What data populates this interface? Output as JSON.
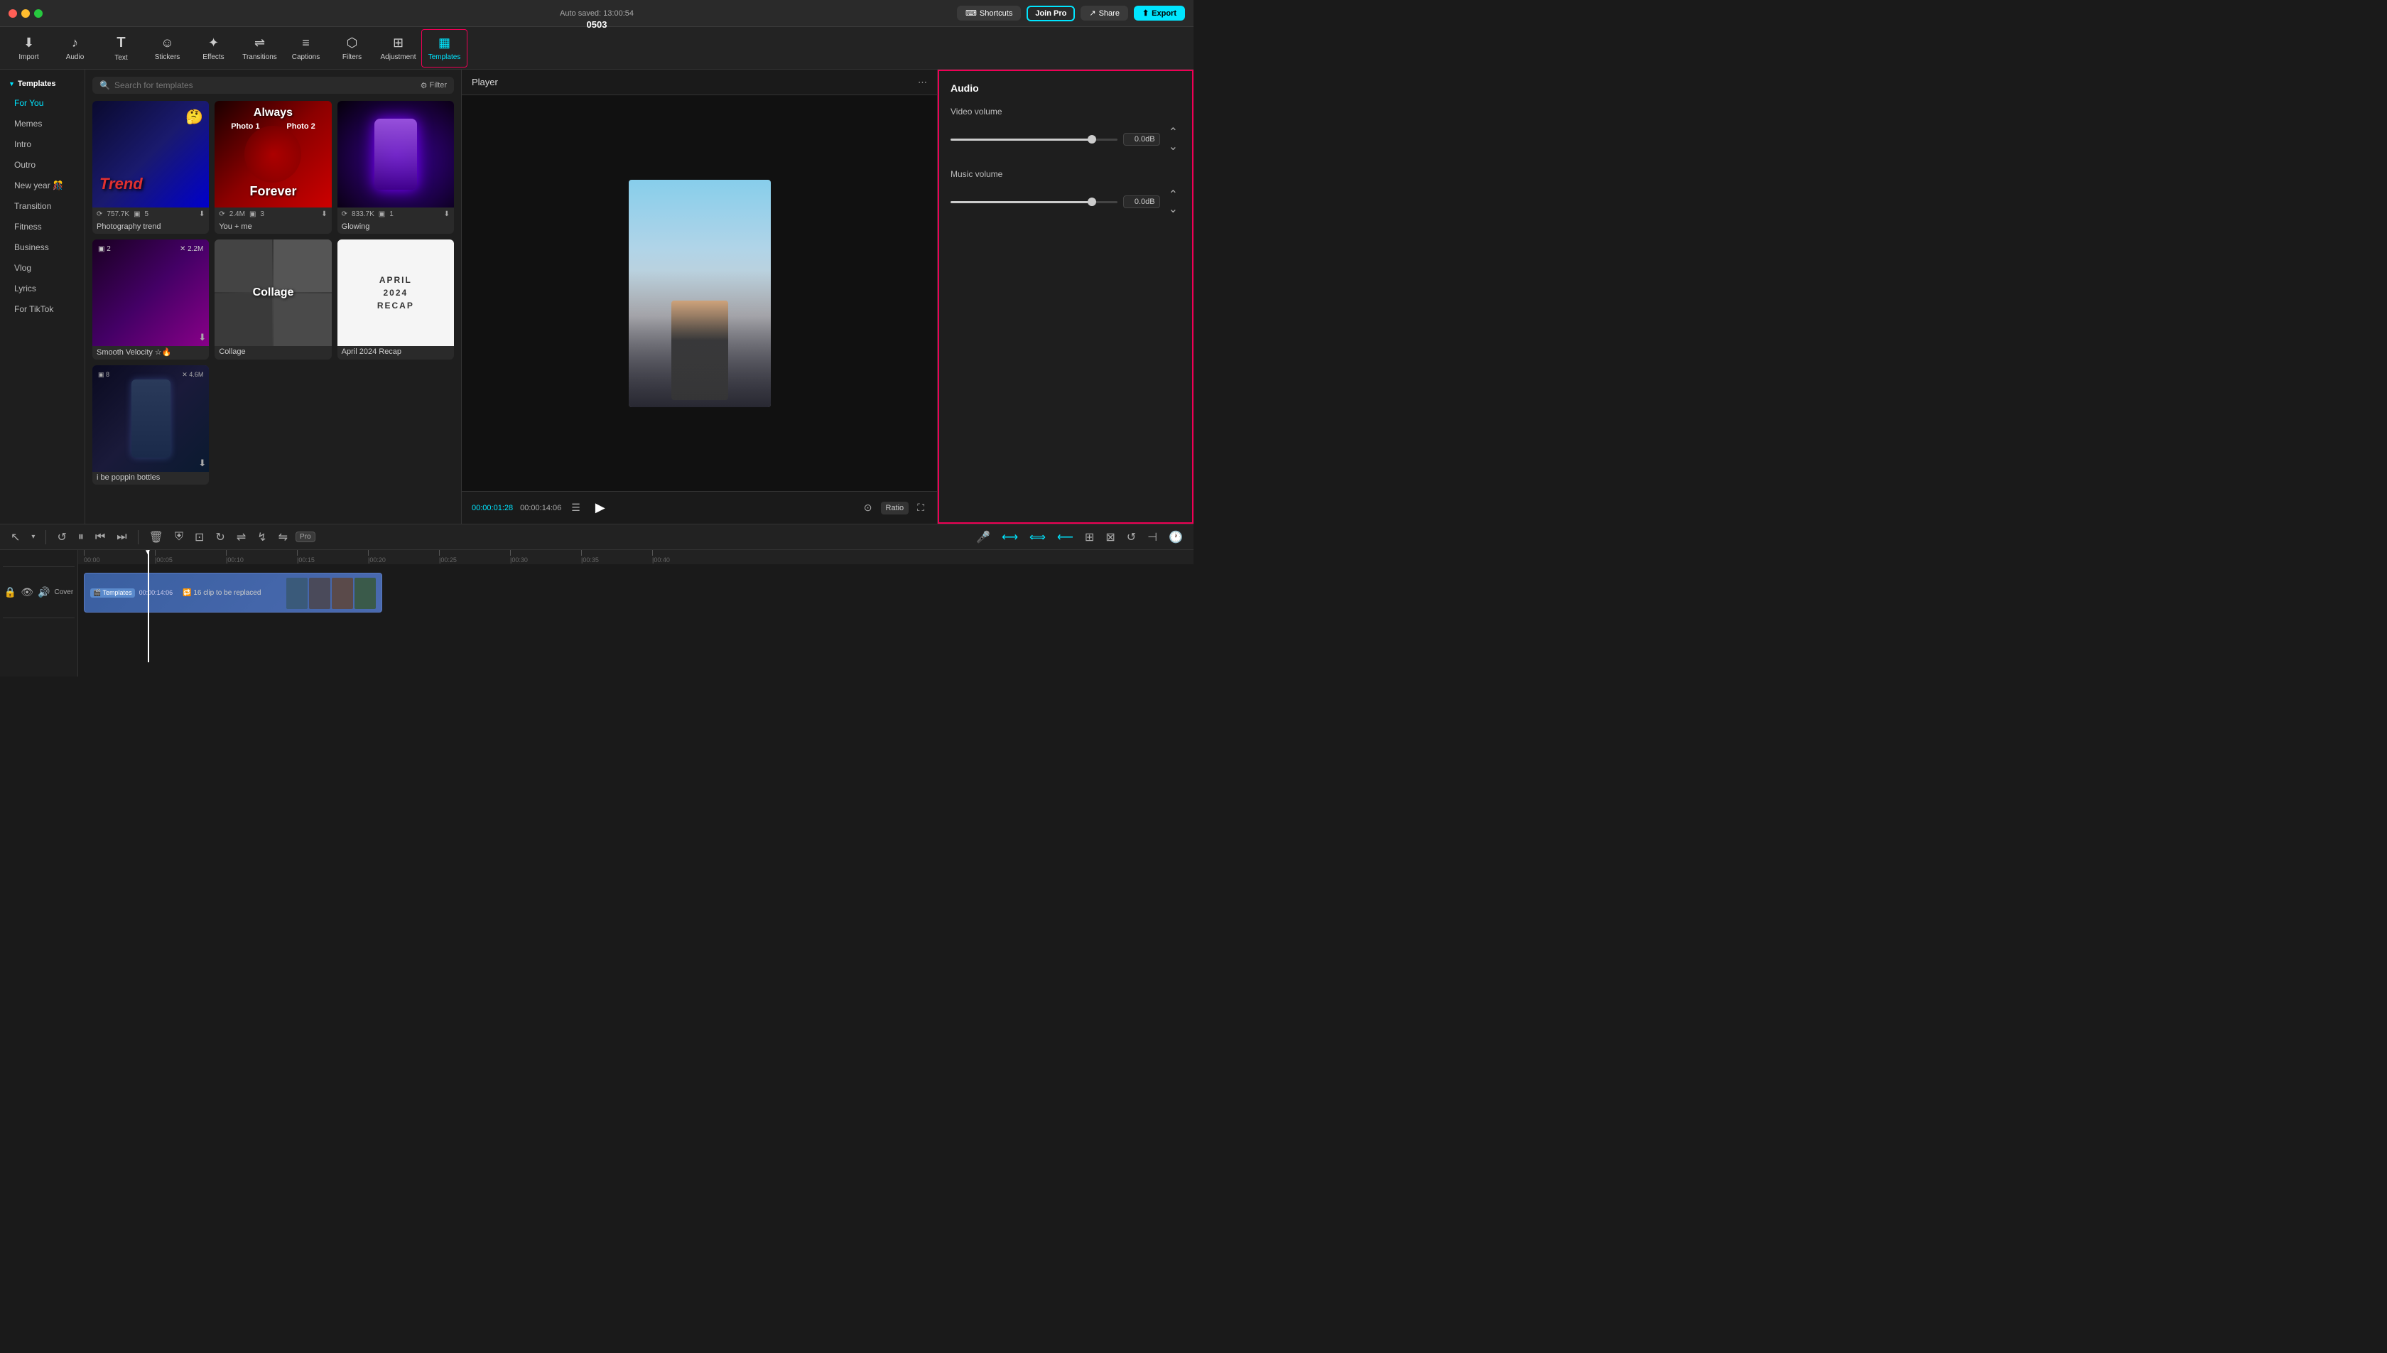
{
  "app": {
    "title": "0503",
    "autosave": "Auto saved: 13:00:54"
  },
  "titlebar": {
    "shortcuts_label": "Shortcuts",
    "joinpro_label": "Join Pro",
    "share_label": "Share",
    "export_label": "Export"
  },
  "toolbar": {
    "items": [
      {
        "id": "import",
        "label": "Import",
        "icon": "⬇"
      },
      {
        "id": "audio",
        "label": "Audio",
        "icon": "♫"
      },
      {
        "id": "text",
        "label": "Text",
        "icon": "T"
      },
      {
        "id": "stickers",
        "label": "Stickers",
        "icon": "★"
      },
      {
        "id": "effects",
        "label": "Effects",
        "icon": "✦"
      },
      {
        "id": "transitions",
        "label": "Transitions",
        "icon": "⇌"
      },
      {
        "id": "captions",
        "label": "Captions",
        "icon": "≡"
      },
      {
        "id": "filters",
        "label": "Filters",
        "icon": "⬡"
      },
      {
        "id": "adjustment",
        "label": "Adjustment",
        "icon": "⊞"
      },
      {
        "id": "templates",
        "label": "Templates",
        "icon": "⊡"
      }
    ]
  },
  "sidebar": {
    "section_label": "Templates",
    "items": [
      {
        "id": "for-you",
        "label": "For You"
      },
      {
        "id": "memes",
        "label": "Memes"
      },
      {
        "id": "intro",
        "label": "Intro"
      },
      {
        "id": "outro",
        "label": "Outro"
      },
      {
        "id": "new-year",
        "label": "New year 🎊"
      },
      {
        "id": "transition",
        "label": "Transition"
      },
      {
        "id": "fitness",
        "label": "Fitness"
      },
      {
        "id": "business",
        "label": "Business"
      },
      {
        "id": "vlog",
        "label": "Vlog"
      },
      {
        "id": "lyrics",
        "label": "Lyrics"
      },
      {
        "id": "for-tiktok",
        "label": "For TikTok"
      }
    ]
  },
  "search": {
    "placeholder": "Search for templates",
    "filter_label": "Filter"
  },
  "templates": [
    {
      "id": "photography-trend",
      "name": "Photography trend",
      "style": "tmpl-blue",
      "text_overlay": "Trend",
      "stats_views": "757.7K",
      "stats_clips": "5",
      "has_download": true
    },
    {
      "id": "you-me",
      "name": "You + me",
      "style": "tmpl-red",
      "text_overlay": "Always\nPhoto1 Photo2\nForever",
      "stats_views": "2.4M",
      "stats_clips": "3",
      "has_download": true
    },
    {
      "id": "glowing",
      "name": "Glowing",
      "style": "tmpl-purple",
      "text_overlay": "",
      "stats_views": "833.7K",
      "stats_clips": "1",
      "has_download": true
    },
    {
      "id": "smooth-velocity",
      "name": "Smooth Velocity ☆🔥",
      "style": "tmpl-pink",
      "text_overlay": "",
      "stats_views": "2.2M",
      "stats_clips": "2",
      "has_download": true
    },
    {
      "id": "collage",
      "name": "Collage",
      "style": "tmpl-collage",
      "text_overlay": "Collage",
      "stats_views": "",
      "stats_clips": "",
      "has_download": false
    },
    {
      "id": "april-recap",
      "name": "April 2024 Recap",
      "style": "tmpl-white",
      "text_overlay": "APRIL\n2024\nRECAP",
      "stats_views": "",
      "stats_clips": "",
      "has_download": false
    },
    {
      "id": "i-be-poppin-bottles",
      "name": "i be poppin bottles",
      "style": "tmpl-bottles",
      "text_overlay": "",
      "stats_views": "4.6M",
      "stats_clips": "8",
      "has_download": true
    }
  ],
  "player": {
    "title": "Player",
    "time_current": "00:00:01:28",
    "time_total": "00:00:14:06",
    "ratio_label": "Ratio"
  },
  "audio": {
    "title": "Audio",
    "video_volume_label": "Video volume",
    "video_volume_value": "0.0dB",
    "video_volume_percent": 85,
    "music_volume_label": "Music volume",
    "music_volume_value": "0.0dB",
    "music_volume_percent": 85
  },
  "timeline": {
    "cover_label": "Cover",
    "clip_badge": "Templates",
    "clip_duration": "00:00:14:06",
    "clip_replace": "🔁 16 clip to be replaced",
    "ruler_marks": [
      "00:00",
      "|00:05",
      "|00:10",
      "|00:15",
      "|00:20",
      "|00:25",
      "|00:30",
      "|00:35",
      "|00:40"
    ]
  }
}
